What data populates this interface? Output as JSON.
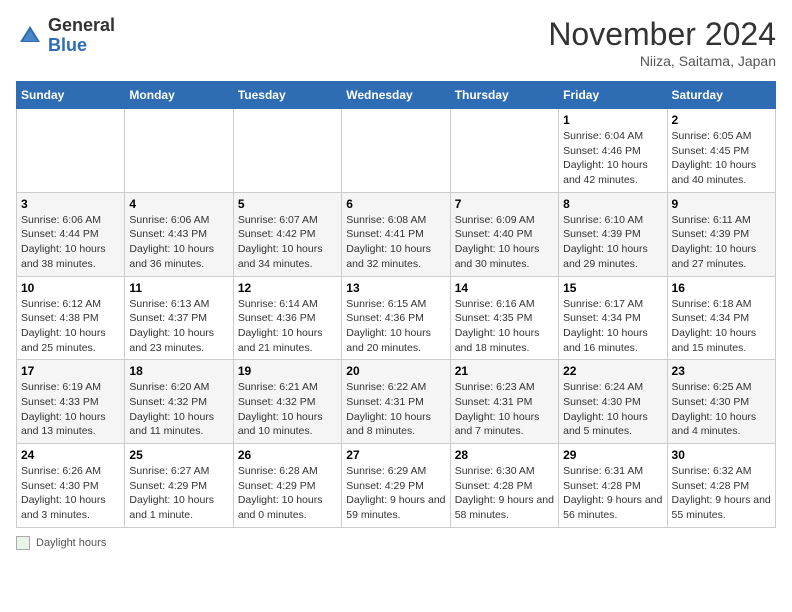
{
  "header": {
    "logo_general": "General",
    "logo_blue": "Blue",
    "month_title": "November 2024",
    "location": "Niiza, Saitama, Japan"
  },
  "weekdays": [
    "Sunday",
    "Monday",
    "Tuesday",
    "Wednesday",
    "Thursday",
    "Friday",
    "Saturday"
  ],
  "legend_label": "Daylight hours",
  "weeks": [
    [
      {
        "day": "",
        "info": ""
      },
      {
        "day": "",
        "info": ""
      },
      {
        "day": "",
        "info": ""
      },
      {
        "day": "",
        "info": ""
      },
      {
        "day": "",
        "info": ""
      },
      {
        "day": "1",
        "info": "Sunrise: 6:04 AM\nSunset: 4:46 PM\nDaylight: 10 hours\nand 42 minutes."
      },
      {
        "day": "2",
        "info": "Sunrise: 6:05 AM\nSunset: 4:45 PM\nDaylight: 10 hours\nand 40 minutes."
      }
    ],
    [
      {
        "day": "3",
        "info": "Sunrise: 6:06 AM\nSunset: 4:44 PM\nDaylight: 10 hours\nand 38 minutes."
      },
      {
        "day": "4",
        "info": "Sunrise: 6:06 AM\nSunset: 4:43 PM\nDaylight: 10 hours\nand 36 minutes."
      },
      {
        "day": "5",
        "info": "Sunrise: 6:07 AM\nSunset: 4:42 PM\nDaylight: 10 hours\nand 34 minutes."
      },
      {
        "day": "6",
        "info": "Sunrise: 6:08 AM\nSunset: 4:41 PM\nDaylight: 10 hours\nand 32 minutes."
      },
      {
        "day": "7",
        "info": "Sunrise: 6:09 AM\nSunset: 4:40 PM\nDaylight: 10 hours\nand 30 minutes."
      },
      {
        "day": "8",
        "info": "Sunrise: 6:10 AM\nSunset: 4:39 PM\nDaylight: 10 hours\nand 29 minutes."
      },
      {
        "day": "9",
        "info": "Sunrise: 6:11 AM\nSunset: 4:39 PM\nDaylight: 10 hours\nand 27 minutes."
      }
    ],
    [
      {
        "day": "10",
        "info": "Sunrise: 6:12 AM\nSunset: 4:38 PM\nDaylight: 10 hours\nand 25 minutes."
      },
      {
        "day": "11",
        "info": "Sunrise: 6:13 AM\nSunset: 4:37 PM\nDaylight: 10 hours\nand 23 minutes."
      },
      {
        "day": "12",
        "info": "Sunrise: 6:14 AM\nSunset: 4:36 PM\nDaylight: 10 hours\nand 21 minutes."
      },
      {
        "day": "13",
        "info": "Sunrise: 6:15 AM\nSunset: 4:36 PM\nDaylight: 10 hours\nand 20 minutes."
      },
      {
        "day": "14",
        "info": "Sunrise: 6:16 AM\nSunset: 4:35 PM\nDaylight: 10 hours\nand 18 minutes."
      },
      {
        "day": "15",
        "info": "Sunrise: 6:17 AM\nSunset: 4:34 PM\nDaylight: 10 hours\nand 16 minutes."
      },
      {
        "day": "16",
        "info": "Sunrise: 6:18 AM\nSunset: 4:34 PM\nDaylight: 10 hours\nand 15 minutes."
      }
    ],
    [
      {
        "day": "17",
        "info": "Sunrise: 6:19 AM\nSunset: 4:33 PM\nDaylight: 10 hours\nand 13 minutes."
      },
      {
        "day": "18",
        "info": "Sunrise: 6:20 AM\nSunset: 4:32 PM\nDaylight: 10 hours\nand 11 minutes."
      },
      {
        "day": "19",
        "info": "Sunrise: 6:21 AM\nSunset: 4:32 PM\nDaylight: 10 hours\nand 10 minutes."
      },
      {
        "day": "20",
        "info": "Sunrise: 6:22 AM\nSunset: 4:31 PM\nDaylight: 10 hours\nand 8 minutes."
      },
      {
        "day": "21",
        "info": "Sunrise: 6:23 AM\nSunset: 4:31 PM\nDaylight: 10 hours\nand 7 minutes."
      },
      {
        "day": "22",
        "info": "Sunrise: 6:24 AM\nSunset: 4:30 PM\nDaylight: 10 hours\nand 5 minutes."
      },
      {
        "day": "23",
        "info": "Sunrise: 6:25 AM\nSunset: 4:30 PM\nDaylight: 10 hours\nand 4 minutes."
      }
    ],
    [
      {
        "day": "24",
        "info": "Sunrise: 6:26 AM\nSunset: 4:30 PM\nDaylight: 10 hours\nand 3 minutes."
      },
      {
        "day": "25",
        "info": "Sunrise: 6:27 AM\nSunset: 4:29 PM\nDaylight: 10 hours\nand 1 minute."
      },
      {
        "day": "26",
        "info": "Sunrise: 6:28 AM\nSunset: 4:29 PM\nDaylight: 10 hours\nand 0 minutes."
      },
      {
        "day": "27",
        "info": "Sunrise: 6:29 AM\nSunset: 4:29 PM\nDaylight: 9 hours\nand 59 minutes."
      },
      {
        "day": "28",
        "info": "Sunrise: 6:30 AM\nSunset: 4:28 PM\nDaylight: 9 hours\nand 58 minutes."
      },
      {
        "day": "29",
        "info": "Sunrise: 6:31 AM\nSunset: 4:28 PM\nDaylight: 9 hours\nand 56 minutes."
      },
      {
        "day": "30",
        "info": "Sunrise: 6:32 AM\nSunset: 4:28 PM\nDaylight: 9 hours\nand 55 minutes."
      }
    ]
  ]
}
